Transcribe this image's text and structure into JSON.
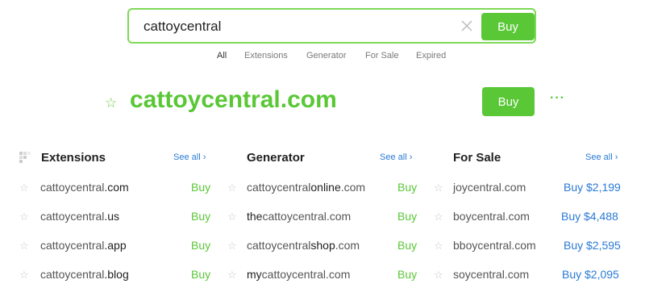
{
  "search": {
    "value": "cattoycentral",
    "buy_label": "Buy"
  },
  "filters": [
    "All",
    "Extensions",
    "Generator",
    "For Sale",
    "Expired"
  ],
  "hero": {
    "domain": "cattoycentral.com",
    "buy_label": "Buy"
  },
  "extensions": {
    "title": "Extensions",
    "see_all": "See all",
    "rows": [
      {
        "base": "cattoycentral",
        "ext": ".com",
        "action": "Buy"
      },
      {
        "base": "cattoycentral",
        "ext": ".us",
        "action": "Buy"
      },
      {
        "base": "cattoycentral",
        "ext": ".app",
        "action": "Buy"
      },
      {
        "base": "cattoycentral",
        "ext": ".blog",
        "action": "Buy"
      }
    ]
  },
  "generator": {
    "title": "Generator",
    "see_all": "See all",
    "rows": [
      {
        "pre": "cattoycentral",
        "bold": "online",
        "post": ".com",
        "action": "Buy"
      },
      {
        "pre": "",
        "bold": "the",
        "post": "cattoycentral.com",
        "action": "Buy"
      },
      {
        "pre": "cattoycentral",
        "bold": "shop",
        "post": ".com",
        "action": "Buy"
      },
      {
        "pre": "",
        "bold": "my",
        "post": "cattoycentral.com",
        "action": "Buy"
      }
    ]
  },
  "for_sale": {
    "title": "For Sale",
    "see_all": "See all",
    "rows": [
      {
        "domain": "joycentral.com",
        "price": "Buy $2,199"
      },
      {
        "domain": "boycentral.com",
        "price": "Buy $4,488"
      },
      {
        "domain": "bboycentral.com",
        "price": "Buy $2,595"
      },
      {
        "domain": "soycentral.com",
        "price": "Buy $2,095"
      }
    ]
  },
  "colors": {
    "accent_green": "#5ac736",
    "border_green": "#7ed957",
    "link_blue": "#2a7ad4"
  }
}
